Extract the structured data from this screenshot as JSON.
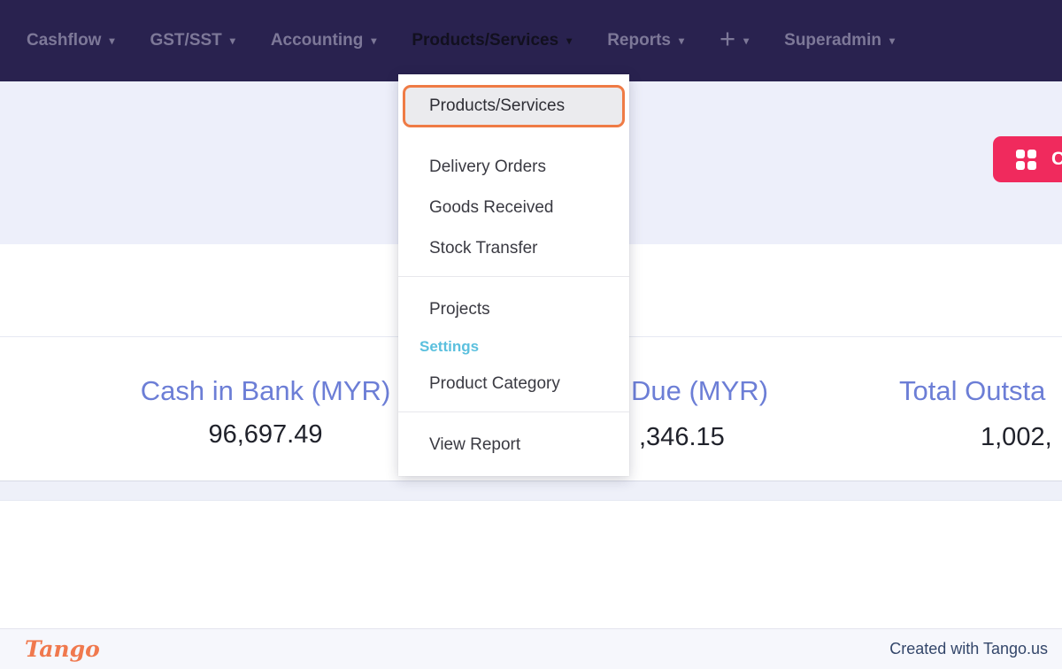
{
  "colors": {
    "navbar_bg": "#29224f",
    "accent_orange": "#ef7b45",
    "button_pink": "#f02a5d",
    "section_blue": "#5bc0de",
    "stat_label_blue": "#6c7ed6"
  },
  "navbar": {
    "caret_glyph": "▾",
    "items": [
      {
        "label": "Cashflow"
      },
      {
        "label": "GST/SST"
      },
      {
        "label": "Accounting"
      },
      {
        "label": "Products/Services",
        "active": true
      },
      {
        "label": "Reports"
      },
      {
        "label": "+"
      },
      {
        "label": "Superadmin"
      }
    ]
  },
  "dropdown": {
    "highlighted_item": "Products/Services",
    "groups": [
      {
        "items": [
          "Delivery Orders",
          "Goods Received",
          "Stock Transfer"
        ]
      },
      {
        "items": [
          "Projects"
        ],
        "section": "Settings",
        "items_after_section": [
          "Product Category"
        ]
      },
      {
        "items": [
          "View Report"
        ]
      }
    ]
  },
  "stats": {
    "items": [
      {
        "label": "Cash in Bank (MYR)",
        "value": "96,697.49"
      },
      {
        "label": "Due (MYR)",
        "value": ",346.15",
        "truncated": true
      },
      {
        "label": "Total Outsta",
        "value": "1,002,",
        "truncated": true
      }
    ]
  },
  "action_button": {
    "icon": "grid-icon",
    "partial_label": "C"
  },
  "footer": {
    "logo_text": "Tango",
    "credit_text": "Created with Tango.us"
  }
}
